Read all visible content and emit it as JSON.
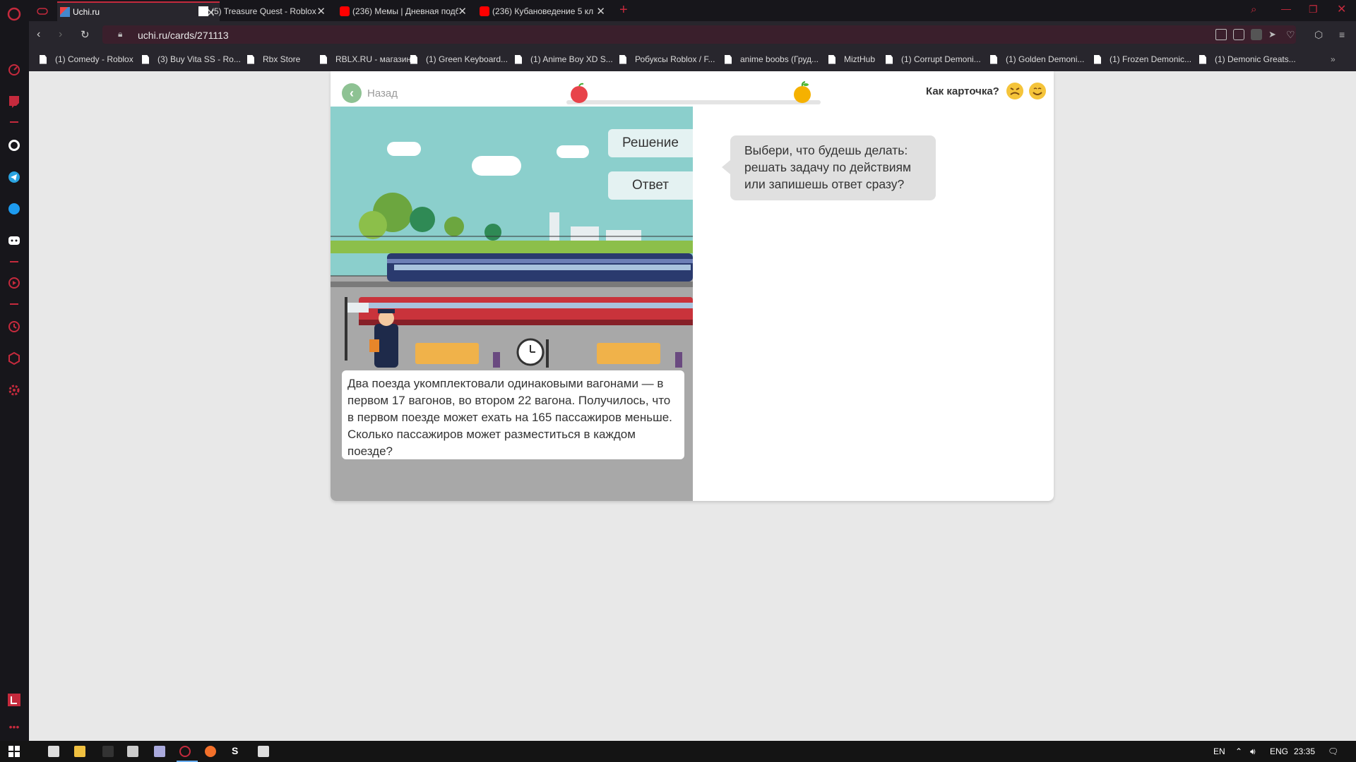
{
  "browser": {
    "tabs": [
      {
        "title": "Uchi.ru",
        "active": true
      },
      {
        "title": "(5) Treasure Quest - Roblox",
        "active": false
      },
      {
        "title": "(236) Мемы | Дневная подб",
        "active": false
      },
      {
        "title": "(236) Кубановедение 5 кл",
        "active": false
      }
    ],
    "url": "uchi.ru/cards/271113",
    "bookmarks": [
      "(1) Comedy - Roblox",
      "(3) Buy Vita SS - Ro...",
      "Rbx Store",
      "RBLX.RU - магазин...",
      "(1) Green Keyboard...",
      "(1) Anime Boy XD S...",
      "Робуксы Roblox / F...",
      "anime boobs (Груд...",
      "MiztHub",
      "(1) Corrupt Demoni...",
      "(1) Golden Demoni...",
      "(1) Frozen Demonic...",
      "(1) Demonic Greats..."
    ]
  },
  "card": {
    "back_label": "Назад",
    "rate_label": "Как карточка?",
    "progress_fraction": 0.0,
    "solution_button": "Решение",
    "answer_button": "Ответ",
    "problem_text": "Два поезда укомплектовали одинаковыми вагонами — в первом 17 вагонов, во втором 22 вагона. Получилось, что в первом поезде может ехать на 165 пассажиров меньше. Сколько пассажиров может разместиться в каждом поезде?",
    "prompt_text": "Выбери, что будешь делать: решать задачу по действиям или запишешь ответ сразу?"
  },
  "taskbar": {
    "lang": "EN",
    "lang2": "ENG",
    "time": "23:35"
  },
  "colors": {
    "accent": "#c52a3d",
    "back_green": "#8ec293",
    "sky": "#8bcfcc"
  }
}
